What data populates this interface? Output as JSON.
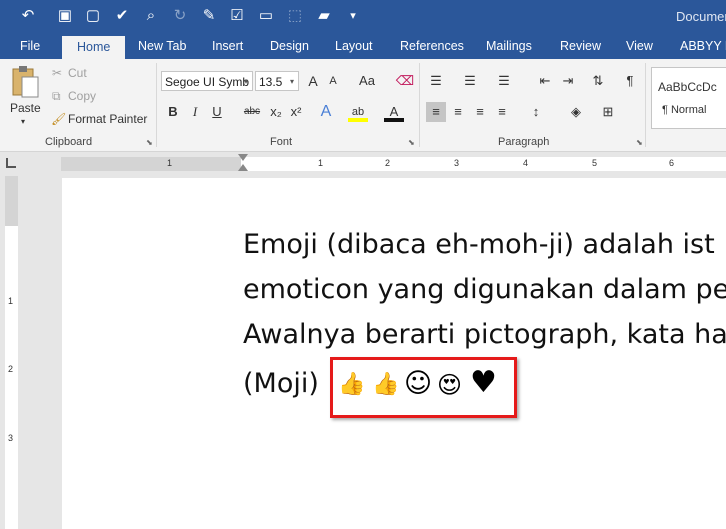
{
  "title_bar": {
    "document_title": "Documen"
  },
  "quick_access": [
    {
      "icon": "undo-icon",
      "glyph": "↶"
    },
    {
      "icon": "save-icon",
      "glyph": "▣"
    },
    {
      "icon": "new-document-icon",
      "glyph": "▢"
    },
    {
      "icon": "save-check-icon",
      "glyph": "✔"
    },
    {
      "icon": "print-preview-icon",
      "glyph": "⌕"
    },
    {
      "icon": "redo-icon",
      "glyph": "↻"
    },
    {
      "icon": "edit-icon",
      "glyph": "✎"
    },
    {
      "icon": "check-box-icon",
      "glyph": "☑"
    },
    {
      "icon": "comment-icon",
      "glyph": "▭"
    },
    {
      "icon": "select-area-icon",
      "glyph": "⬚"
    },
    {
      "icon": "open-folder-icon",
      "glyph": "▰"
    },
    {
      "icon": "customize-icon",
      "glyph": "▾"
    }
  ],
  "tabs": [
    "File",
    "Home",
    "New Tab",
    "Insert",
    "Design",
    "Layout",
    "References",
    "Mailings",
    "Review",
    "View",
    "ABBYY F"
  ],
  "clipboard": {
    "paste": "Paste",
    "cut": "Cut",
    "copy": "Copy",
    "format_painter": "Format Painter",
    "group_label": "Clipboard"
  },
  "font": {
    "font_name": "Segoe UI Symb",
    "font_size": "13.5",
    "group_label": "Font",
    "grow": "A",
    "shrink": "A",
    "case": "Aa",
    "bold": "B",
    "italic": "I",
    "underline": "U",
    "strike": "abc",
    "subscript": "x₂",
    "superscript": "x²",
    "effects": "A",
    "highlight": "ab",
    "color": "A"
  },
  "paragraph": {
    "group_label": "Paragraph",
    "show_marks": "¶"
  },
  "styles": {
    "normal_preview": "AaBbCcDc",
    "normal_label": "¶ Normal"
  },
  "document": {
    "lines": [
      "Emoji (dibaca eh-moh-ji) adalah ist",
      "emoticon yang digunakan dalam pe",
      "Awalnya berarti pictograph, kata ha",
      "(Moji)"
    ],
    "emojis": [
      {
        "name": "thumbs-up-emoji-1",
        "glyph": "👍"
      },
      {
        "name": "thumbs-up-emoji-2",
        "glyph": "👍"
      },
      {
        "name": "smiling-face-emoji",
        "glyph": "☺"
      },
      {
        "name": "heart-eyes-emoji",
        "glyph": "😍"
      },
      {
        "name": "black-heart-emoji",
        "glyph": "♥"
      }
    ]
  },
  "ruler_numbers": [
    "1",
    "1",
    "2",
    "3",
    "4",
    "5",
    "6"
  ],
  "vruler_numbers": [
    "1",
    "2",
    "3"
  ],
  "colors": {
    "accent": "#2b579a",
    "highlight_box": "#e51a1a"
  }
}
